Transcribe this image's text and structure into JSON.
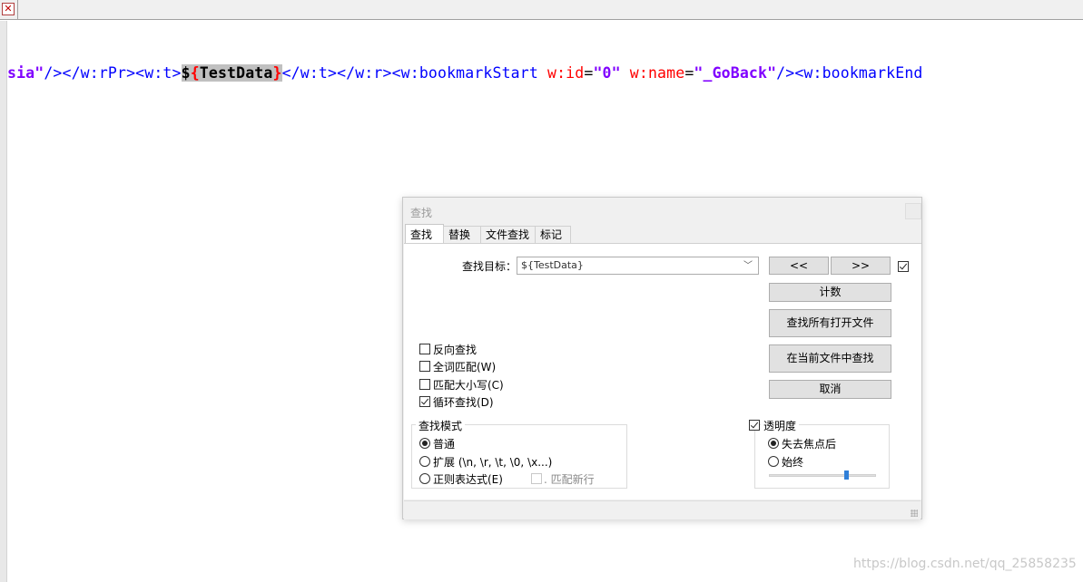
{
  "editor": {
    "code_segments": [
      {
        "text": "sia\"",
        "cls": "c-val"
      },
      {
        "text": "/></w:rPr><w:t>",
        "cls": "c-tag"
      },
      {
        "text": "$",
        "cls": "c-hl"
      },
      {
        "text": "{",
        "cls": "c-hl c-brace"
      },
      {
        "text": "TestData",
        "cls": "c-hl"
      },
      {
        "text": "}",
        "cls": "c-hl c-brace"
      },
      {
        "text": "</w:t></w:r><w:bookmarkStart ",
        "cls": "c-tag"
      },
      {
        "text": "w:id",
        "cls": "c-attr"
      },
      {
        "text": "=",
        "cls": "c-plain"
      },
      {
        "text": "\"0\"",
        "cls": "c-val"
      },
      {
        "text": " ",
        "cls": "c-plain"
      },
      {
        "text": "w:name",
        "cls": "c-attr"
      },
      {
        "text": "=",
        "cls": "c-plain"
      },
      {
        "text": "\"_GoBack\"",
        "cls": "c-val"
      },
      {
        "text": "/><w:bookmarkEnd",
        "cls": "c-tag"
      }
    ]
  },
  "dialog": {
    "title": "查找",
    "tabs": [
      "查找",
      "替换",
      "文件查找",
      "标记"
    ],
    "find_label": "查找目标：",
    "find_value": "${TestData}",
    "prev_label": "<<",
    "next_label": ">>",
    "count_label": "计数",
    "find_all_open_label": "查找所有打开文件",
    "find_in_current_label": "在当前文件中查找",
    "cancel_label": "取消",
    "options": {
      "reverse": "反向查找",
      "whole_word": "全词匹配(W)",
      "match_case": "匹配大小写(C)",
      "wrap": "循环查找(D)"
    },
    "search_mode": {
      "title": "查找模式",
      "normal": "普通",
      "extended": "扩展 (\\n, \\r, \\t, \\0, \\x...)",
      "regex": "正则表达式(E)",
      "dot_newline": ". 匹配新行"
    },
    "transparency": {
      "title": "透明度",
      "on_lose_focus": "失去焦点后",
      "always": "始终",
      "level": 0.72
    }
  },
  "watermark": "https://blog.csdn.net/qq_25858235",
  "colors": {
    "tag": "#0000ff",
    "attr": "#ff0000",
    "value": "#8000ff",
    "highlight": "#c0c0c0",
    "slider": "#2f7fd8"
  }
}
